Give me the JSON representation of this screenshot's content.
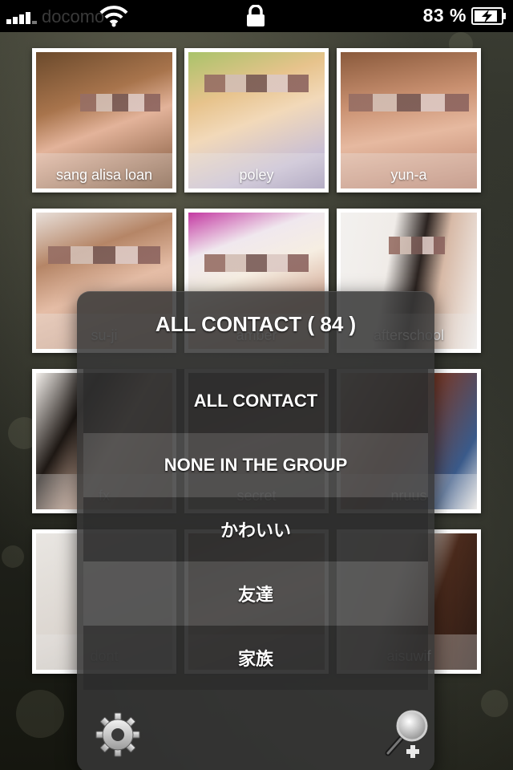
{
  "status_bar": {
    "carrier": "docomo",
    "battery_percent": "83 %",
    "icons": [
      "signal-icon",
      "wifi-icon",
      "lock-icon",
      "battery-charging-icon"
    ]
  },
  "contacts": [
    {
      "name": "sang alisa loan"
    },
    {
      "name": "poley"
    },
    {
      "name": "yun-a"
    },
    {
      "name": "su-ji"
    },
    {
      "name": "amber"
    },
    {
      "name": "afterschool"
    },
    {
      "name": "fx"
    },
    {
      "name": "secret"
    },
    {
      "name": "nruus"
    },
    {
      "name": "dont"
    },
    {
      "name": ""
    },
    {
      "name": "aisuwif"
    }
  ],
  "group_picker": {
    "title": "ALL CONTACT ( 84 )",
    "groups": [
      {
        "label": "ALL CONTACT"
      },
      {
        "label": "NONE IN THE GROUP"
      },
      {
        "label": "かわいい"
      },
      {
        "label": "友達"
      },
      {
        "label": "家族"
      }
    ],
    "toolbar_icons": [
      "gear-icon",
      "search-add-icon"
    ]
  },
  "colors": {
    "status_bar_bg": "#000000",
    "tile_border": "#ffffff",
    "popover_bg": "#373737"
  }
}
